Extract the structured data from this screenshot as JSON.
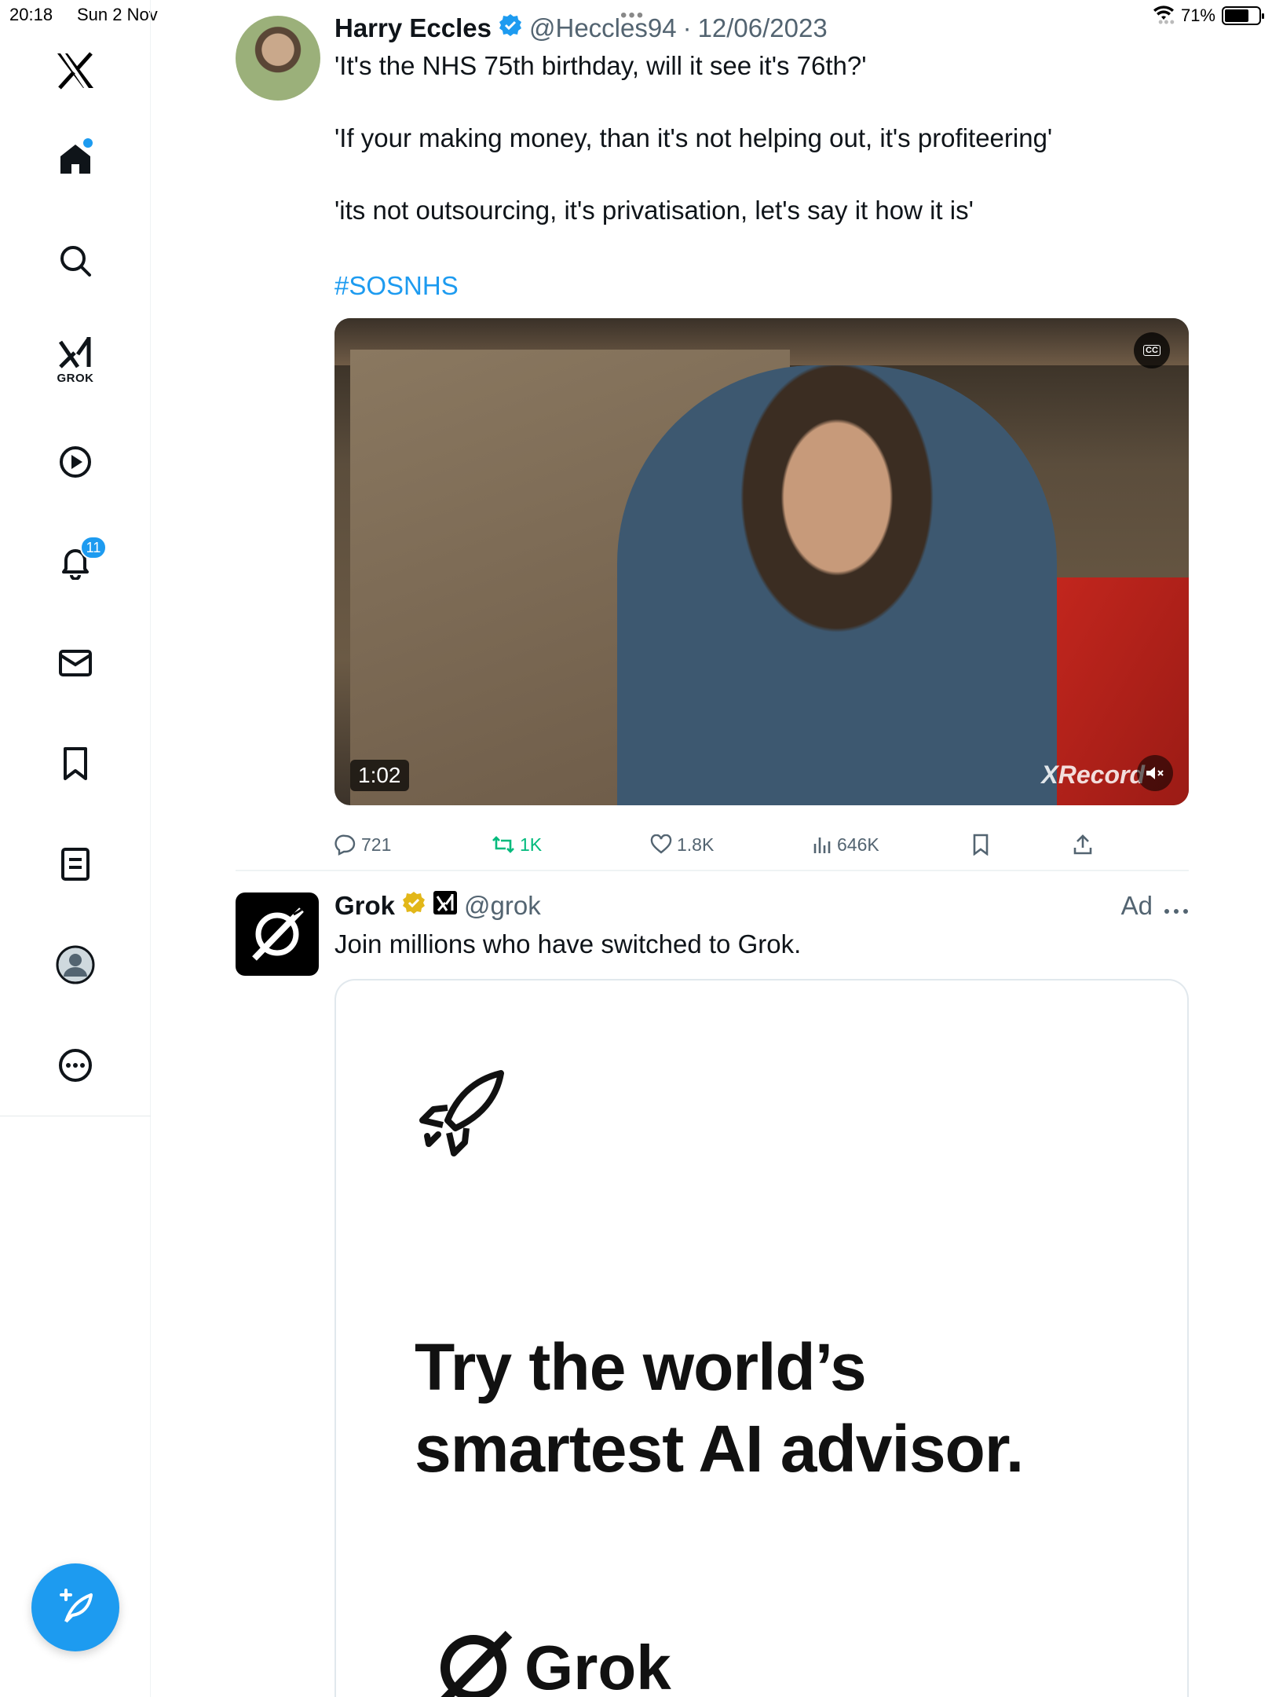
{
  "status_bar": {
    "time": "20:18",
    "date": "Sun 2 Nov",
    "battery": "71%",
    "battery_level": 0.71
  },
  "sidebar": {
    "items": [
      {
        "name": "home",
        "icon": "home-icon"
      },
      {
        "name": "search",
        "icon": "search-icon"
      },
      {
        "name": "grok",
        "icon": "grok-icon",
        "label": "GROK"
      },
      {
        "name": "videos",
        "icon": "play-circle-icon"
      },
      {
        "name": "notifications",
        "icon": "bell-icon",
        "badge": "11"
      },
      {
        "name": "messages",
        "icon": "mail-icon"
      },
      {
        "name": "bookmarks",
        "icon": "bookmark-icon"
      },
      {
        "name": "lists",
        "icon": "list-icon"
      },
      {
        "name": "profile",
        "icon": "profile-icon"
      },
      {
        "name": "more",
        "icon": "more-icon"
      }
    ]
  },
  "tweet": {
    "author": "Harry Eccles",
    "handle": "@Heccles94",
    "separator": "·",
    "date": "12/06/2023",
    "lines": [
      "'It's the NHS 75th birthday, will it see it's 76th?'",
      "'If your making money, than it's not helping out, it's profiteering'",
      "'its not outsourcing, it's privatisation, let's say it how it is'"
    ],
    "hashtag": "#SOSNHS",
    "video": {
      "duration": "1:02",
      "watermark": "XRecord",
      "cc": "CC"
    },
    "stats": {
      "replies": "721",
      "reposts": "1K",
      "likes": "1.8K",
      "views": "646K"
    }
  },
  "ad": {
    "author": "Grok",
    "handle": "@grok",
    "label": "Ad",
    "text": "Join millions who have switched to Grok.",
    "headline_line1": "Try the world’s",
    "headline_line2": "smartest AI advisor.",
    "wordmark": "Grok"
  },
  "colors": {
    "accent": "#1d9bf0",
    "text": "#0f1419",
    "secondary": "#536471",
    "repost_active": "#00ba7c",
    "gold_badge": "#e2b719"
  }
}
